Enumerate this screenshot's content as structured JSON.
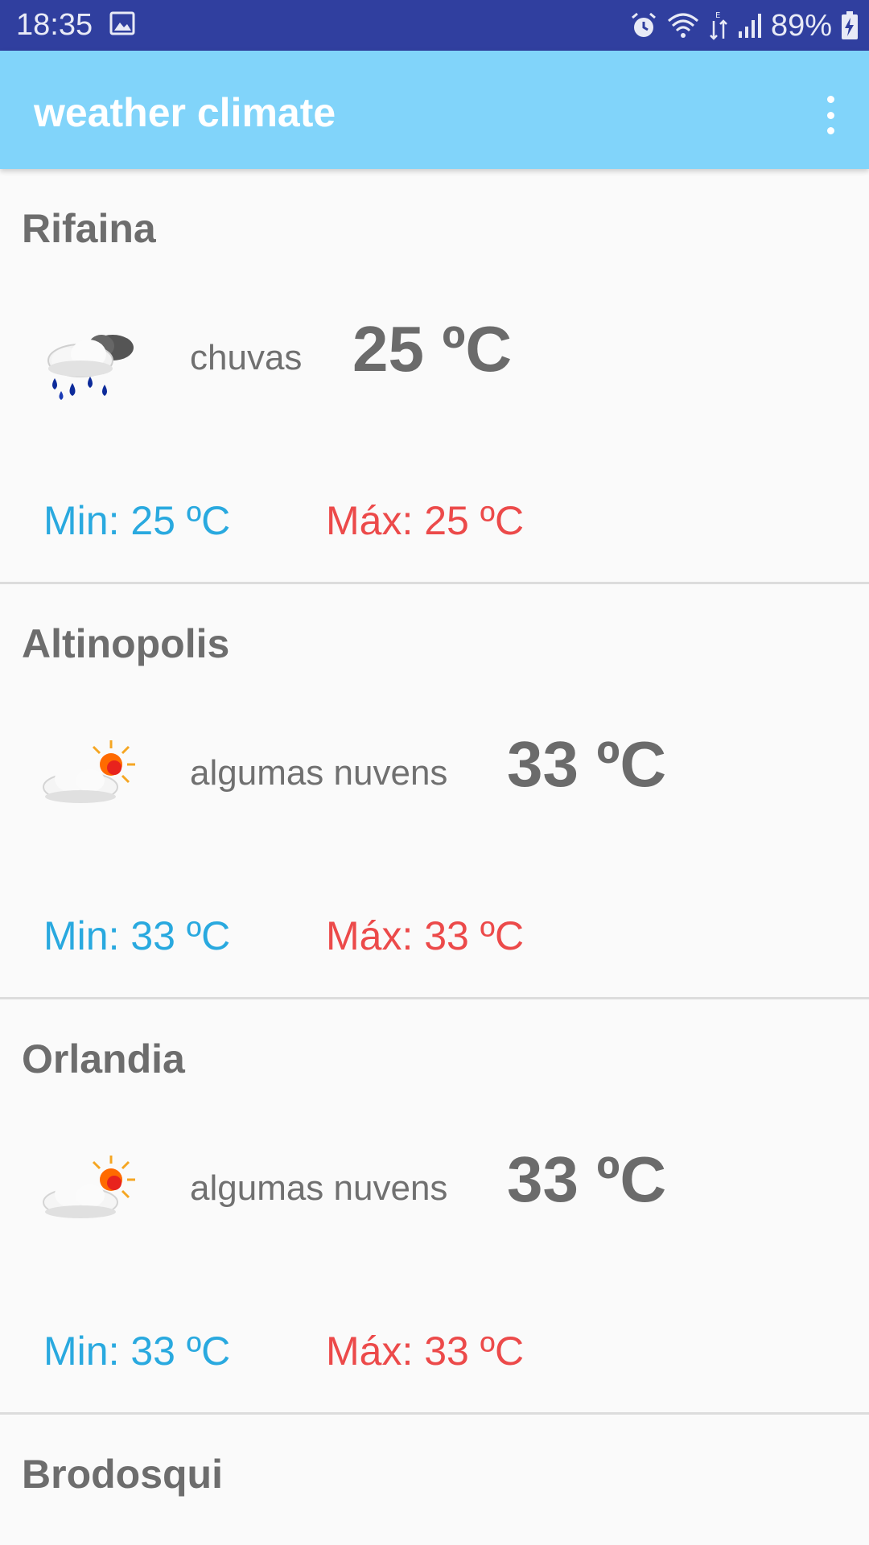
{
  "status_bar": {
    "time": "18:35",
    "battery": "89%",
    "icons": [
      "image-icon",
      "alarm-icon",
      "wifi-icon",
      "data-transfer-icon",
      "signal-icon",
      "battery-charging-icon"
    ],
    "background": "#303f9f"
  },
  "app_bar": {
    "title": "weather climate",
    "background": "#81d4fa",
    "menu_icon": "overflow-menu-icon"
  },
  "colors": {
    "min": "#29a9df",
    "max": "#ec4a4a",
    "text": "#6d6d6d"
  },
  "cities": [
    {
      "name": "Rifaina",
      "icon": "rain-cloud-icon",
      "condition": "chuvas",
      "temp": "25 ºC",
      "min": "Min: 25 ºC",
      "max": "Máx: 25 ºC"
    },
    {
      "name": "Altinopolis",
      "icon": "partly-cloudy-icon",
      "condition": "algumas nuvens",
      "temp": "33 ºC",
      "min": "Min: 33 ºC",
      "max": "Máx: 33 ºC"
    },
    {
      "name": "Orlandia",
      "icon": "partly-cloudy-icon",
      "condition": "algumas nuvens",
      "temp": "33 ºC",
      "min": "Min: 33 ºC",
      "max": "Máx: 33 ºC"
    },
    {
      "name": "Brodosqui"
    }
  ]
}
